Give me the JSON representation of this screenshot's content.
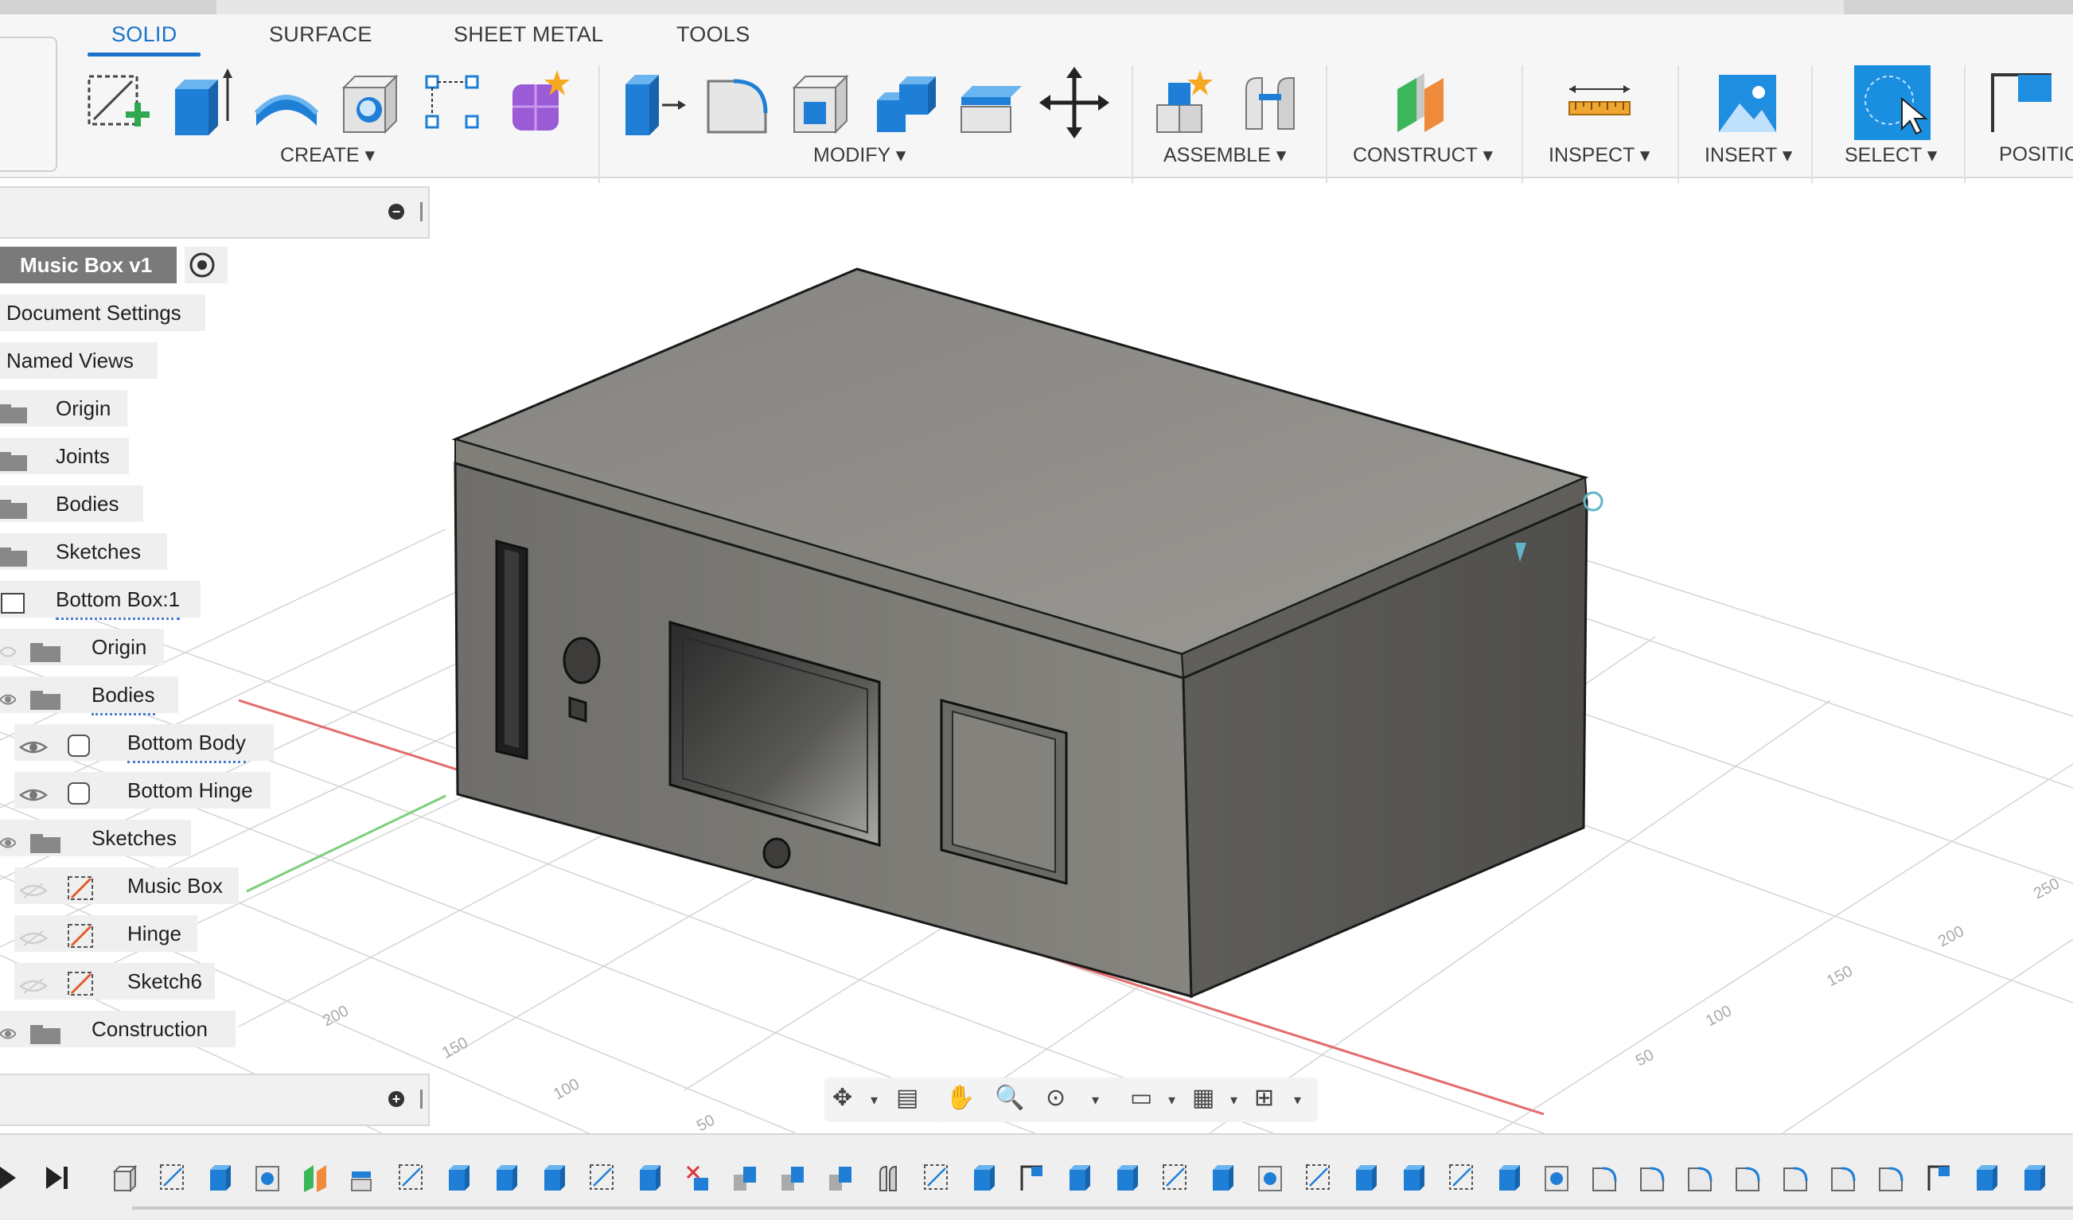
{
  "tabs": [
    {
      "label": "SOLID",
      "active": true
    },
    {
      "label": "SURFACE",
      "active": false
    },
    {
      "label": "SHEET METAL",
      "active": false
    },
    {
      "label": "TOOLS",
      "active": false
    }
  ],
  "groups": {
    "create": "CREATE",
    "modify": "MODIFY",
    "assemble": "ASSEMBLE",
    "construct": "CONSTRUCT",
    "inspect": "INSPECT",
    "insert": "INSERT",
    "select": "SELECT",
    "position": "POSITIO"
  },
  "dropdown_glyph": "▾",
  "browser": {
    "root": "Music Box v1",
    "items": [
      {
        "label": "Document Settings"
      },
      {
        "label": "Named Views"
      },
      {
        "label": "Origin"
      },
      {
        "label": "Joints"
      },
      {
        "label": "Bodies"
      },
      {
        "label": "Sketches"
      },
      {
        "label": "Bottom Box:1"
      },
      {
        "label": "Origin"
      },
      {
        "label": "Bodies"
      },
      {
        "label": "Bottom Body"
      },
      {
        "label": "Bottom Hinge"
      },
      {
        "label": "Sketches"
      },
      {
        "label": "Music Box"
      },
      {
        "label": "Hinge"
      },
      {
        "label": "Sketch6"
      },
      {
        "label": "Construction"
      }
    ]
  },
  "grid_labels": [
    "50",
    "100",
    "150",
    "200",
    "250",
    "50",
    "100",
    "150",
    "200"
  ],
  "colors": {
    "accent": "#1a73c8",
    "select_active": "#1a8fe0",
    "box_top": "#8d8b86",
    "box_front": "#7b7a75",
    "box_side": "#5d5c58"
  }
}
